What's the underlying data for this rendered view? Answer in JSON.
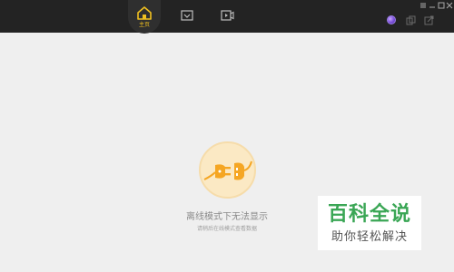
{
  "nav": {
    "home_label": "主页",
    "items": [
      {
        "icon": "home-icon"
      },
      {
        "icon": "inbox-icon"
      },
      {
        "icon": "video-icon"
      }
    ]
  },
  "window_controls": [
    "menu-icon",
    "minimize-icon",
    "maximize-icon",
    "close-icon"
  ],
  "top_right": [
    "avatar-icon",
    "copy-icon",
    "export-icon"
  ],
  "main": {
    "offline_message": "离线模式下无法显示",
    "offline_hint": "请稍后在线模式查看数据"
  },
  "watermark": {
    "title": "百科全说",
    "subtitle": "助你轻松解决"
  },
  "colors": {
    "topbar": "#232323",
    "background": "#efefef",
    "accent": "#f0c020",
    "plug_bg": "#fbe9c4",
    "plug": "#f5a623",
    "watermark_green": "#3aa655"
  }
}
